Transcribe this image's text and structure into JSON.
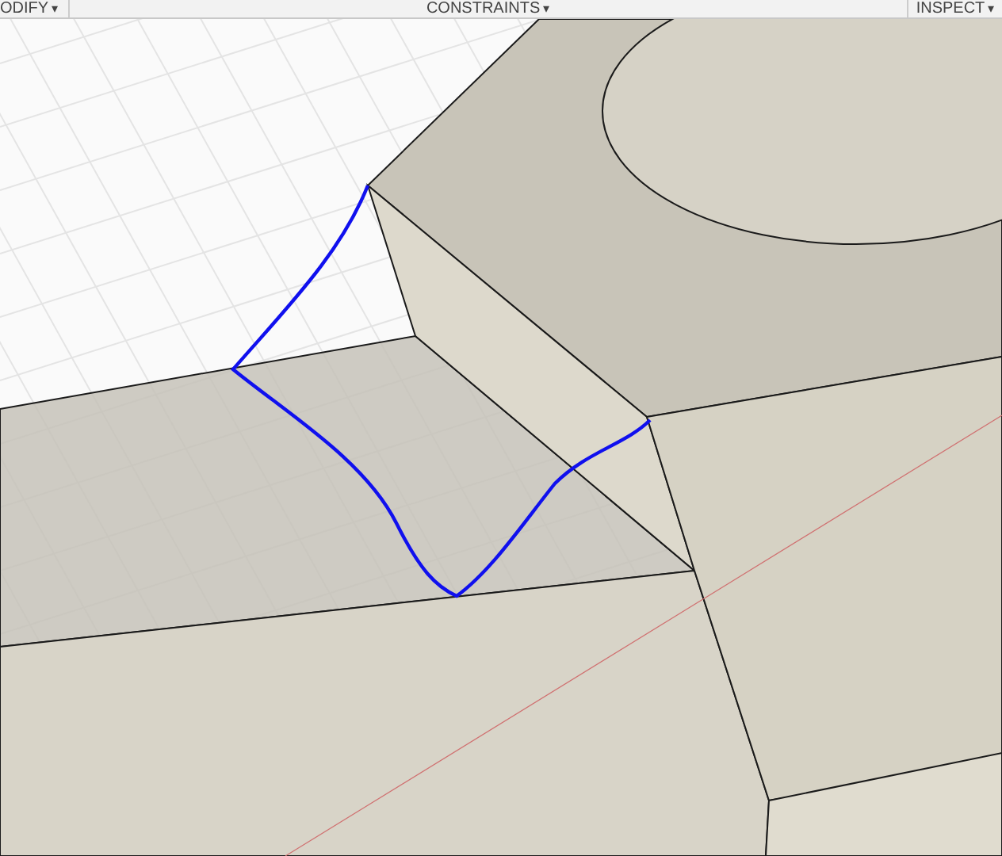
{
  "toolbar": {
    "menus": [
      {
        "label": "ODIFY",
        "caret": "▾"
      },
      {
        "label": "CONSTRAINTS",
        "caret": "▾"
      },
      {
        "label": "INSPECT",
        "caret": "▾"
      }
    ]
  }
}
